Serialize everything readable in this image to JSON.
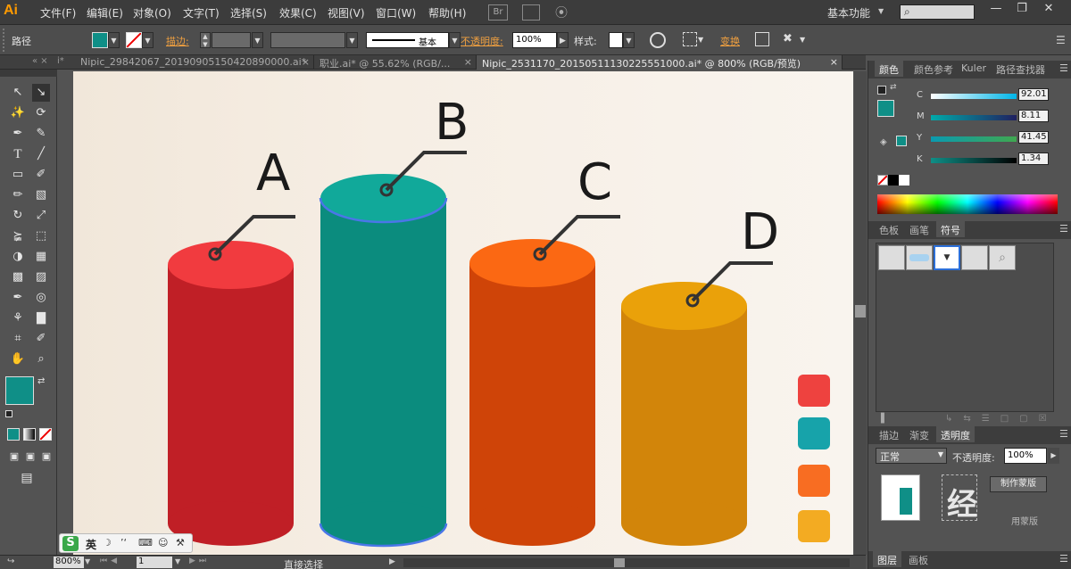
{
  "app": {
    "logo": "Ai",
    "menus": [
      "文件(F)",
      "编辑(E)",
      "对象(O)",
      "文字(T)",
      "选择(S)",
      "效果(C)",
      "视图(V)",
      "窗口(W)",
      "帮助(H)"
    ],
    "workspace": "基本功能",
    "br_label": "Br"
  },
  "control_bar": {
    "selection_label": "路径",
    "fill_color": "#0f8f87",
    "stroke_label": "描边:",
    "stroke_style": "基本",
    "opacity_label": "不透明度:",
    "opacity_value": "100%",
    "style_label": "样式:",
    "transform_label": "变换"
  },
  "tabs": [
    {
      "label": "Nipic_29842067_20190905150420890000.ai*",
      "active": false
    },
    {
      "label": "职业.ai* @ 55.62% (RGB/...",
      "active": false
    },
    {
      "label": "Nipic_2531170_20150511130225551000.ai* @ 800% (RGB/预览)",
      "active": true
    }
  ],
  "chart": {
    "labels": [
      "A",
      "B",
      "C",
      "D"
    ],
    "colors": {
      "A_top": "#f13b3f",
      "A_body": "#c01f26",
      "B_top": "#11a99a",
      "B_body": "#0b8c7e",
      "C_top": "#fb6813",
      "C_body": "#cf4408",
      "D_top": "#eaa10a",
      "D_body": "#d2850a"
    },
    "swatches": [
      "#ee423f",
      "#17a3aa",
      "#f86d22",
      "#f3ab22"
    ]
  },
  "right_panel": {
    "color_tabs": [
      "颜色",
      "颜色参考",
      "Kuler",
      "路径查找器"
    ],
    "cmyk": [
      {
        "channel": "C",
        "value": "92.01"
      },
      {
        "channel": "M",
        "value": "8.11"
      },
      {
        "channel": "Y",
        "value": "41.45"
      },
      {
        "channel": "K",
        "value": "1.34"
      }
    ],
    "swatch_tabs": [
      "色板",
      "画笔",
      "符号"
    ],
    "transparency_tabs": [
      "描边",
      "渐变",
      "透明度"
    ],
    "blend_mode": "正常",
    "opacity_label": "不透明度:",
    "opacity_value": "100%",
    "mask_button": "制作蒙版",
    "mask_label": "用蒙版",
    "bottom_tabs": [
      "图层",
      "画板"
    ]
  },
  "status_bar": {
    "zoom": "800%",
    "page": "1",
    "tool_name": "直接选择"
  },
  "ime": {
    "lang": "英"
  },
  "watermark": "经"
}
